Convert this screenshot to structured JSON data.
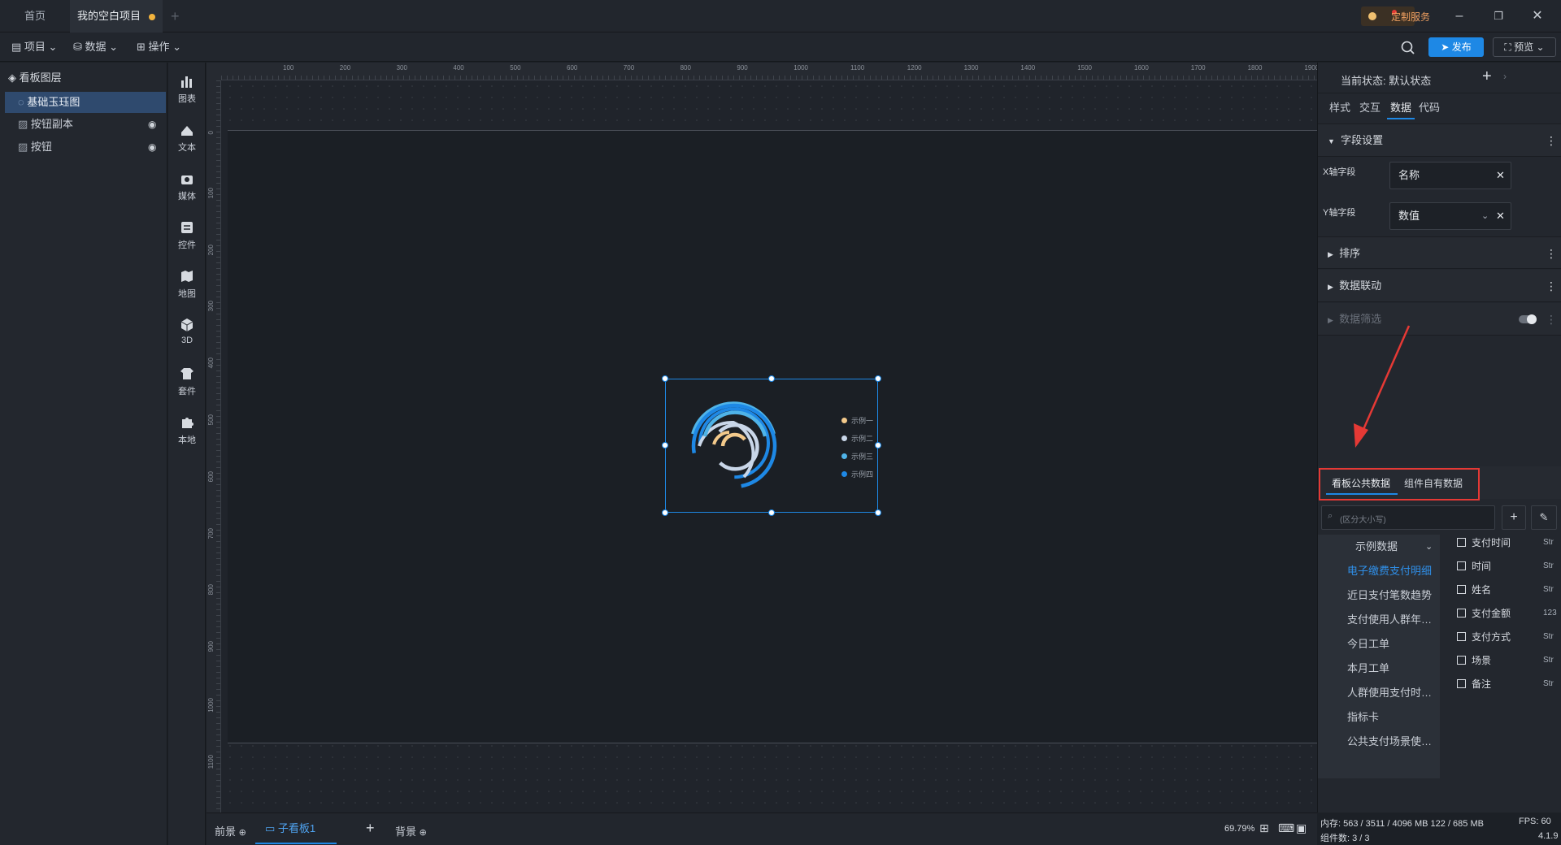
{
  "tabs": [
    {
      "label": "首页"
    },
    {
      "label": "我的空白项目"
    }
  ],
  "title_bar": {
    "custom_service": "定制服务"
  },
  "toolbar": {
    "project": "项目",
    "data": "数据",
    "operation": "操作",
    "publish": "发布",
    "preview": "预览"
  },
  "layers": {
    "title": "看板图层",
    "items": [
      {
        "label": "基础玉珏图"
      },
      {
        "label": "按钮副本"
      },
      {
        "label": "按钮"
      }
    ]
  },
  "components": [
    {
      "label": "图表"
    },
    {
      "label": "文本"
    },
    {
      "label": "媒体"
    },
    {
      "label": "控件"
    },
    {
      "label": "地图"
    },
    {
      "label": "3D"
    },
    {
      "label": "套件"
    },
    {
      "label": "本地"
    }
  ],
  "ruler": {
    "top_ticks": [
      "100",
      "200",
      "300",
      "400",
      "500",
      "600",
      "700",
      "800",
      "900",
      "1000",
      "1100",
      "1200",
      "1300",
      "1400",
      "1500",
      "1600",
      "1700",
      "1800",
      "1900"
    ],
    "left_ticks": [
      "0",
      "100",
      "200",
      "300",
      "400",
      "500",
      "600",
      "700",
      "800",
      "900",
      "1000",
      "1100"
    ]
  },
  "chart": {
    "legend": [
      "示例一",
      "示例二",
      "示例三",
      "示例四"
    ],
    "colors": [
      "#f3c98b",
      "#c9d6e8",
      "#4fb3e8",
      "#1e88e5"
    ]
  },
  "bottom": {
    "front": "前景",
    "subboard": "子看板1",
    "background": "背景",
    "zoom": "69.79%"
  },
  "right_panel": {
    "state_label": "当前状态:",
    "state_value": "默认状态",
    "tabs": [
      "样式",
      "交互",
      "数据",
      "代码"
    ],
    "field_settings": "字段设置",
    "x_field_label": "X轴字段",
    "x_field_value": "名称",
    "y_field_label": "Y轴字段",
    "y_field_value": "数值",
    "sort": "排序",
    "linkage": "数据联动",
    "filter": "数据筛选",
    "data_tabs": [
      "看板公共数据",
      "组件自有数据"
    ],
    "search_placeholder": "(区分大小写)",
    "dataset_group": "示例数据",
    "datasets": [
      "电子缴费支付明细",
      "近日支付笔数趋势",
      "支付使用人群年龄...",
      "今日工单",
      "本月工单",
      "人群使用支付时间...",
      "指标卡",
      "公共支付场景使用..."
    ],
    "fields": [
      {
        "name": "支付时间",
        "type": "Str"
      },
      {
        "name": "时间",
        "type": "Str"
      },
      {
        "name": "姓名",
        "type": "Str"
      },
      {
        "name": "支付金额",
        "type": "123"
      },
      {
        "name": "支付方式",
        "type": "Str"
      },
      {
        "name": "场景",
        "type": "Str"
      },
      {
        "name": "备注",
        "type": "Str"
      }
    ]
  },
  "status": {
    "memory": "内存: 563 / 3511 / 4096 MB 122 / 685 MB",
    "fps": "FPS: 60",
    "components": "组件数: 3 / 3",
    "version": "4.1.9"
  },
  "colors": {
    "accent": "#1e88e5",
    "highlight_red": "#e53935",
    "selected_layer": "#2f4a6e"
  }
}
